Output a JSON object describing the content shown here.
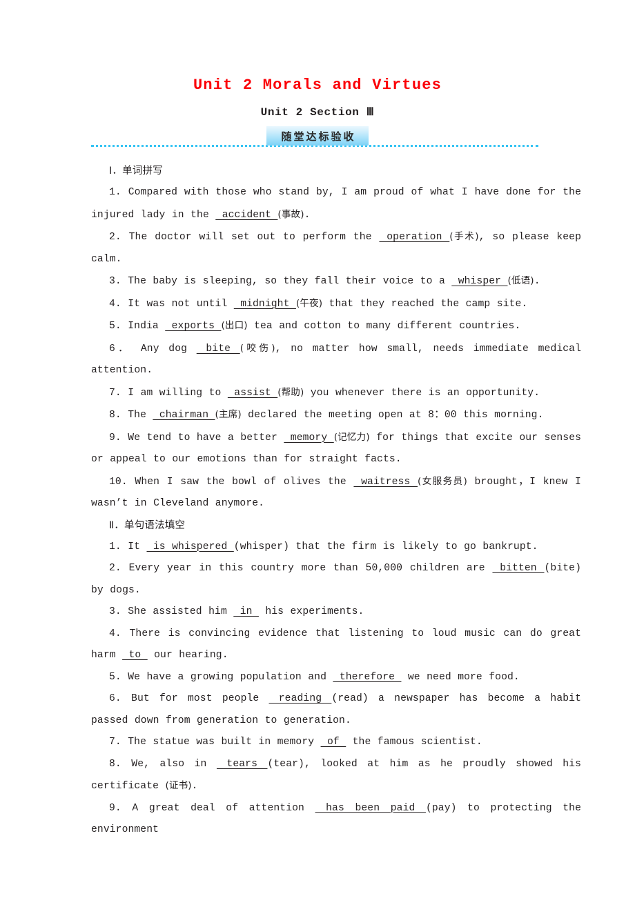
{
  "header": {
    "title": "Unit 2 Morals and Virtues",
    "subtitle": "Unit 2  Section Ⅲ",
    "banner_label": "随堂达标验收",
    "title_color": "#fb0007",
    "banner_color": "#7cd2f6",
    "rule_color": "#35c3f3"
  },
  "sections": [
    {
      "heading": "Ⅰ．单词拼写",
      "items": [
        {
          "number": "1.",
          "pre": " Compared with those who stand by, I am proud of what I have done for the injured lady in the ",
          "blank": "accident",
          "hint": "(事故)",
          "post": "."
        },
        {
          "number": "2.",
          "pre": " The doctor will set out to perform the ",
          "blank": "operation",
          "hint": "(手术)",
          "post": ", so please keep calm."
        },
        {
          "number": "3.",
          "pre": " The baby is sleeping, so they fall their voice to a ",
          "blank": "whisper",
          "hint": "(低语)",
          "post": "."
        },
        {
          "number": "4.",
          "pre": " It was not until ",
          "blank": "midnight",
          "hint": "(午夜)",
          "post": " that they reached the camp site."
        },
        {
          "number": "5.",
          "pre": " India ",
          "blank": "exports",
          "hint": "(出口)",
          "post": " tea and cotton to many different countries."
        },
        {
          "number": "6．",
          "pre": " Any dog ",
          "blank": "bite",
          "hint": "(咬伤)",
          "post": ", no matter how small, needs immediate medical attention."
        },
        {
          "number": "7.",
          "pre": " I am willing to ",
          "blank": "assist",
          "hint": "(帮助)",
          "post": " you whenever there is an opportunity."
        },
        {
          "number": "8.",
          "pre": " The ",
          "blank": "chairman",
          "hint": "(主席)",
          "post": " declared the meeting open at 8：00 this morning."
        },
        {
          "number": "9.",
          "pre": " We tend to have a better ",
          "blank": "memory",
          "hint": "(记忆力)",
          "post": " for things that excite our senses or appeal to our emotions than for straight facts."
        },
        {
          "number": "10.",
          "pre": " When I saw the bowl of olives the ",
          "blank": "waitress",
          "hint": "(女服务员)",
          "post": " brought，I knew I wasn’t in Cleveland anymore."
        }
      ]
    },
    {
      "heading": "Ⅱ．单句语法填空",
      "items": [
        {
          "number": "1.",
          "pre": " It ",
          "blank": "is whispered",
          "hint": "(whisper)",
          "post": " that the firm is likely to go bankrupt."
        },
        {
          "number": "2.",
          "pre": " Every year in this country more than 50,000 children are ",
          "blank": "bitten",
          "hint": "(bite)",
          "post": " by dogs."
        },
        {
          "number": "3.",
          "pre": " She assisted him ",
          "blank": "in",
          "hint": "",
          "post": " his experiments."
        },
        {
          "number": "4.",
          "pre": " There is convincing evidence that listening to loud music can do great harm ",
          "blank": "to",
          "hint": "",
          "post": " our hearing."
        },
        {
          "number": "5.",
          "pre": " We have a growing population and ",
          "blank": "therefore",
          "hint": "",
          "post": " we need more food."
        },
        {
          "number": "6.",
          "pre": " But for most people ",
          "blank": "reading",
          "hint": "(read)",
          "post": " a newspaper has become a habit passed down from generation to generation."
        },
        {
          "number": "7.",
          "pre": " The statue was built in memory ",
          "blank": "of",
          "hint": "",
          "post": " the famous scientist."
        },
        {
          "number": "8.",
          "pre": " We, also in ",
          "blank": "tears",
          "hint": "(tear)",
          "post": ", looked at him as he proudly showed his certificate (证书)."
        },
        {
          "number": "9.",
          "pre": " A great deal of attention ",
          "blank": "has been paid",
          "hint": "(pay)",
          "post": " to protecting the environment"
        }
      ]
    }
  ]
}
